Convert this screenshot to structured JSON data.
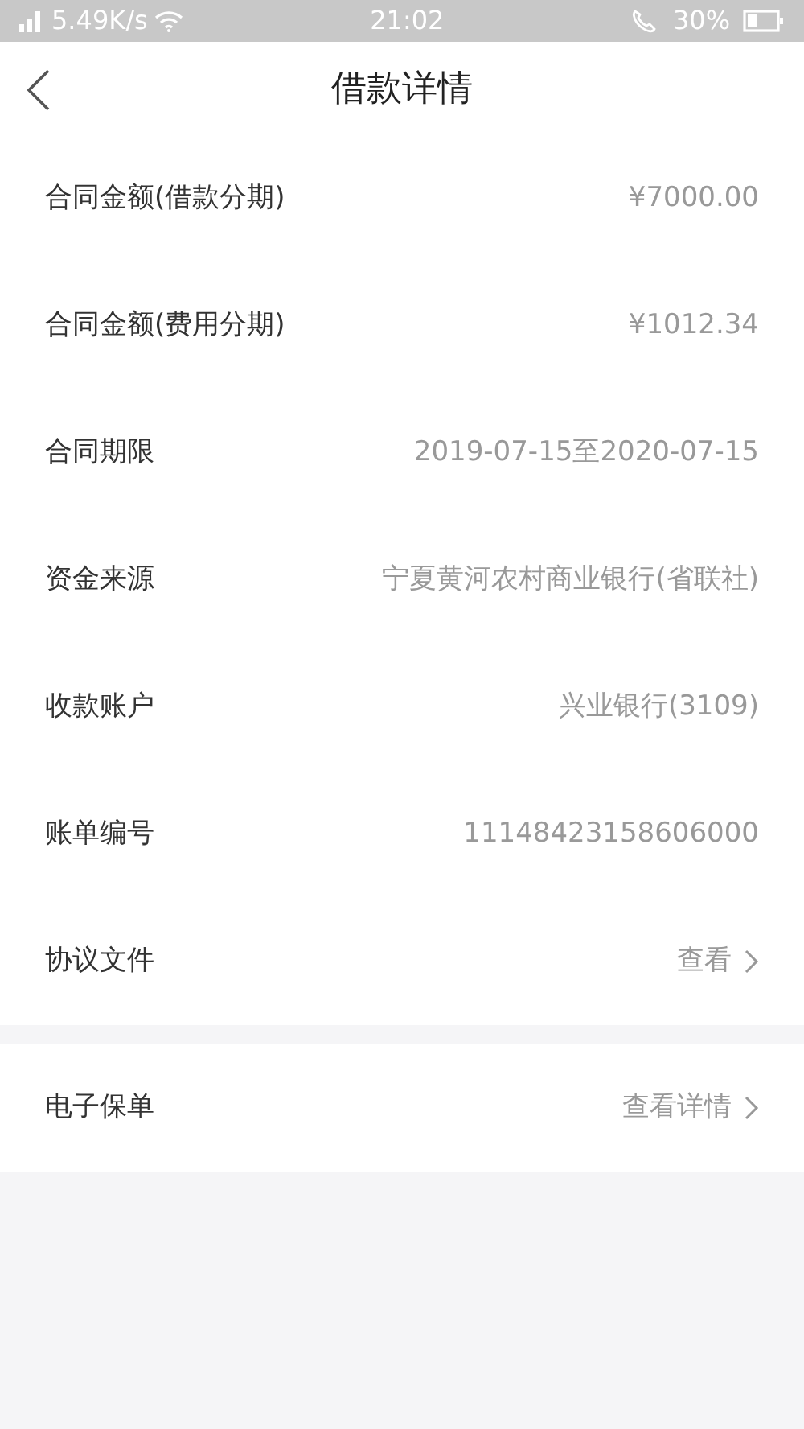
{
  "status_bar": {
    "speed": "5.49K/s",
    "time": "21:02",
    "battery": "30%"
  },
  "header": {
    "title": "借款详情"
  },
  "sections": [
    {
      "rows": [
        {
          "label": "合同金额(借款分期)",
          "value": "¥7000.00",
          "kind": "info"
        },
        {
          "label": "合同金额(费用分期)",
          "value": "¥1012.34",
          "kind": "info"
        },
        {
          "label": "合同期限",
          "value": "2019-07-15至2020-07-15",
          "kind": "info"
        },
        {
          "label": "资金来源",
          "value": "宁夏黄河农村商业银行(省联社)",
          "kind": "info"
        },
        {
          "label": "收款账户",
          "value": "兴业银行(3109)",
          "kind": "info"
        },
        {
          "label": "账单编号",
          "value": "11148423158606000",
          "kind": "info"
        },
        {
          "label": "协议文件",
          "value": "查看",
          "kind": "link"
        }
      ]
    },
    {
      "rows": [
        {
          "label": "电子保单",
          "value": "查看详情",
          "kind": "link"
        }
      ]
    }
  ]
}
